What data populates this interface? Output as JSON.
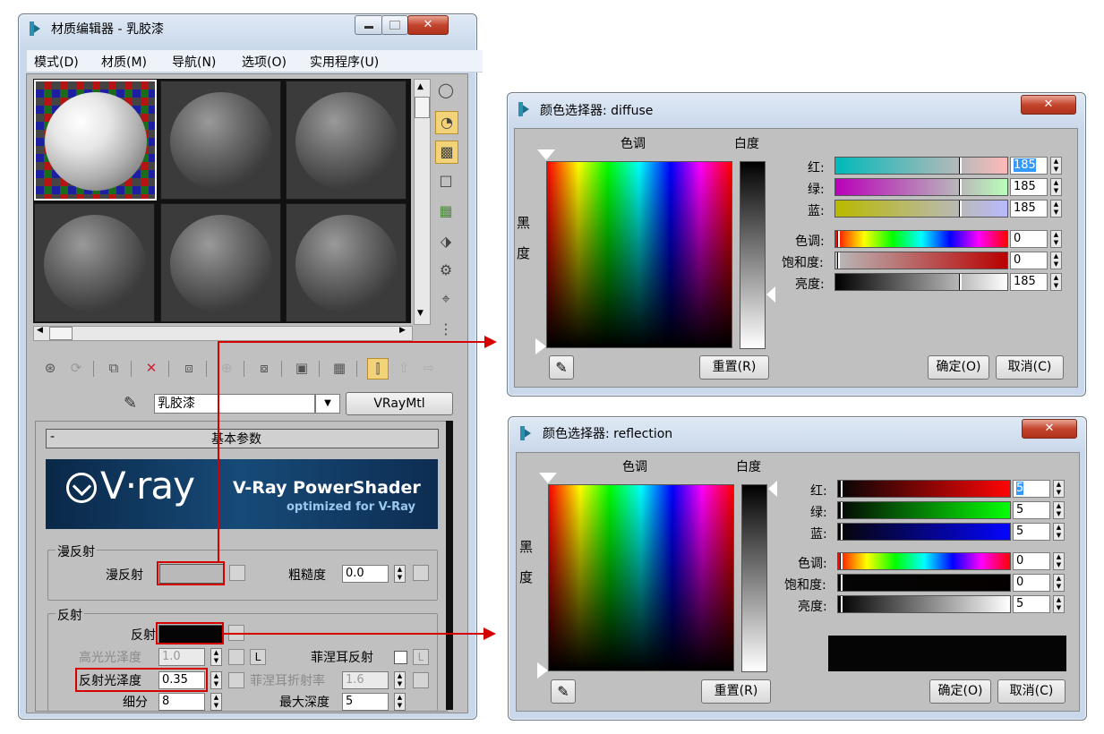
{
  "material_editor": {
    "title": "材质编辑器 - 乳胶漆",
    "menu": [
      "模式(D)",
      "材质(M)",
      "导航(N)",
      "选项(O)",
      "实用程序(U)"
    ],
    "material_name": "乳胶漆",
    "material_type": "VRayMtl",
    "rollout_title": "基本参数",
    "vray_logo": "V·ray",
    "vray_banner_title": "V-Ray PowerShader",
    "vray_banner_subtitle": "optimized for V-Ray",
    "diffuse_group": {
      "title": "漫反射",
      "diffuse_label": "漫反射",
      "diffuse_color": "#b9b9b9",
      "roughness_label": "粗糙度",
      "roughness_value": "0.0"
    },
    "reflect_group": {
      "title": "反射",
      "reflect_label": "反射",
      "reflect_color": "#050505",
      "hilight_gloss_label": "高光光泽度",
      "hilight_gloss_value": "1.0",
      "lock_label": "L",
      "fresnel_label": "菲涅耳反射",
      "fresnel_lock_label": "L",
      "refl_gloss_label": "反射光泽度",
      "refl_gloss_value": "0.35",
      "fresnel_ior_label": "菲涅耳折射率",
      "fresnel_ior_value": "1.6",
      "subdivs_label": "细分",
      "subdivs_value": "8",
      "max_depth_label": "最大深度",
      "max_depth_value": "5"
    },
    "side_tools": [
      "sample-type-icon",
      "backlight-icon",
      "background-icon",
      "uv-tiling-icon",
      "video-check-icon",
      "make-preview-icon",
      "options-icon",
      "select-by-material-icon",
      "material-nav-icon"
    ],
    "bottom_tools": [
      "get-material-icon",
      "put-to-scene-icon",
      "assign-icon",
      "reset-icon",
      "make-copy-icon",
      "make-unique-icon",
      "put-to-library-icon",
      "material-id-icon",
      "show-map-icon",
      "show-end-icon",
      "go-parent-icon",
      "go-sibling-icon"
    ]
  },
  "color_pickers": [
    {
      "title": "颜色选择器: diffuse",
      "hue_label": "色调",
      "whiteness_label": "白度",
      "black_label": [
        "黑",
        "度"
      ],
      "rows": [
        {
          "label": "红:",
          "value": "185",
          "selected": true
        },
        {
          "label": "绿:",
          "value": "185"
        },
        {
          "label": "蓝:",
          "value": "185"
        },
        {
          "label": "色调:",
          "value": "0"
        },
        {
          "label": "饱和度:",
          "value": "0"
        },
        {
          "label": "亮度:",
          "value": "185"
        }
      ],
      "reset_label": "重置(R)",
      "ok_label": "确定(O)",
      "cancel_label": "取消(C)",
      "swatch_color": "#b9b9b9"
    },
    {
      "title": "颜色选择器: reflection",
      "hue_label": "色调",
      "whiteness_label": "白度",
      "black_label": [
        "黑",
        "度"
      ],
      "rows": [
        {
          "label": "红:",
          "value": "5",
          "selected": true
        },
        {
          "label": "绿:",
          "value": "5"
        },
        {
          "label": "蓝:",
          "value": "5"
        },
        {
          "label": "色调:",
          "value": "0"
        },
        {
          "label": "饱和度:",
          "value": "0"
        },
        {
          "label": "亮度:",
          "value": "5"
        }
      ],
      "reset_label": "重置(R)",
      "ok_label": "确定(O)",
      "cancel_label": "取消(C)",
      "swatch_color": "#050505"
    }
  ],
  "colors": {
    "highlight_red": "#d40000",
    "window_frame": "#c9d8ea",
    "panel_gray": "#c0c0c0"
  }
}
